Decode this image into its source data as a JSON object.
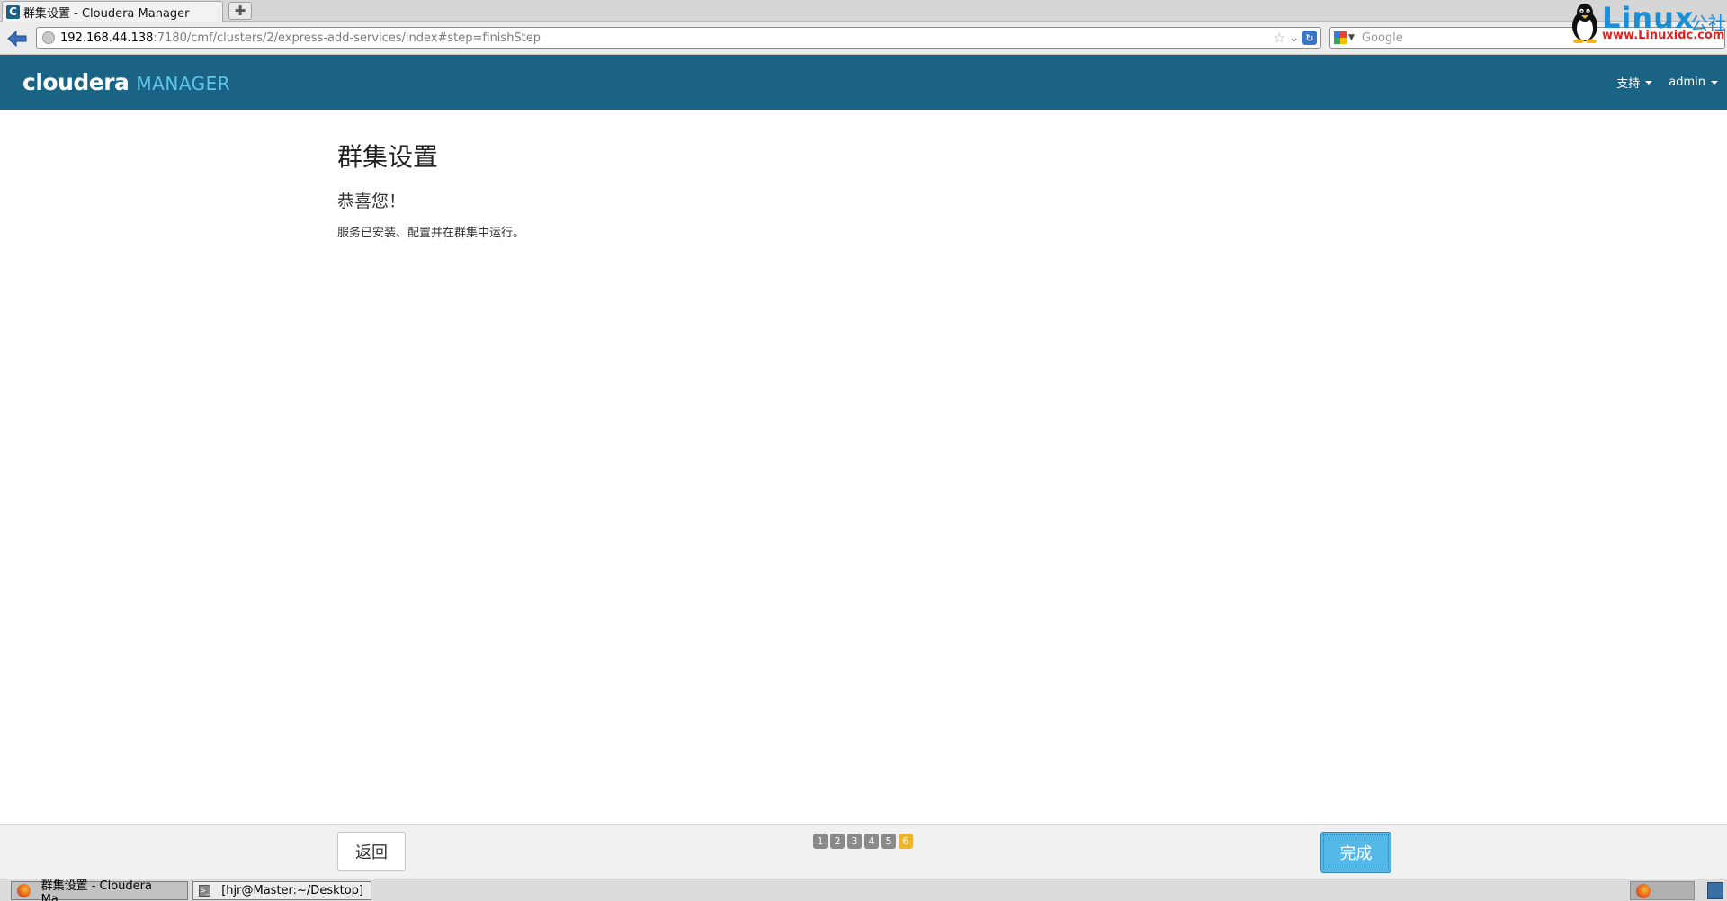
{
  "browser": {
    "tab_title": "群集设置 - Cloudera Manager",
    "tab_favicon": "C",
    "newtab_symbol": "✚",
    "url_host": "192.168.44.138",
    "url_path": ":7180/cmf/clusters/2/express-add-services/index#step=finishStep",
    "search_placeholder": "Google"
  },
  "watermark": {
    "main": "Linux",
    "cn": "公社",
    "url": "www.Linuxidc.com"
  },
  "header": {
    "logo_main": "cloudera",
    "logo_sub": "MANAGER",
    "menu": [
      {
        "label": "支持"
      },
      {
        "label": "admin"
      }
    ],
    "colors": {
      "background": "#1b6384",
      "logo_accent": "#5cc7ec"
    }
  },
  "main": {
    "title": "群集设置",
    "subtitle": "恭喜您！",
    "message": "服务已安装、配置并在群集中运行。"
  },
  "wizard": {
    "back_label": "返回",
    "finish_label": "完成",
    "steps": [
      "1",
      "2",
      "3",
      "4",
      "5",
      "6"
    ],
    "current_step": 6,
    "colors": {
      "active_step": "#f0b428",
      "step": "#8a8a8a",
      "finish_button": "#56b8e6"
    }
  },
  "taskbar": {
    "items": [
      {
        "label": "群集设置 - Cloudera Ma..."
      },
      {
        "label": "[hjr@Master:~/Desktop]"
      }
    ]
  }
}
